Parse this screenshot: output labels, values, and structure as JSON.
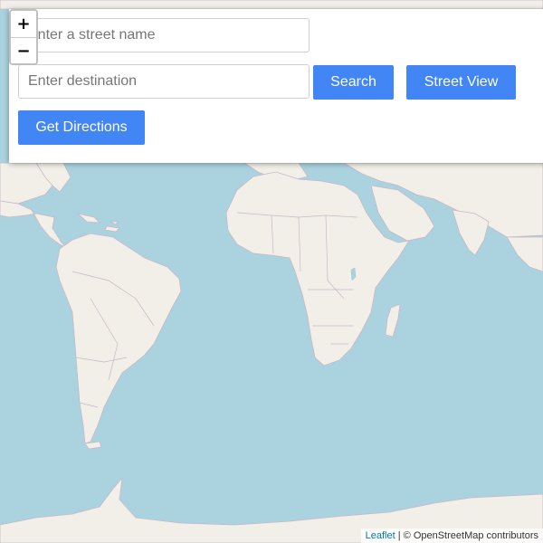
{
  "panel": {
    "street_placeholder": "Enter a street name",
    "destination_placeholder": "Enter destination",
    "search_label": "Search",
    "street_view_label": "Street View",
    "directions_label": "Get Directions"
  },
  "zoom": {
    "in_label": "+",
    "out_label": "−"
  },
  "attribution": {
    "leaflet_label": "Leaflet",
    "separator": " | © ",
    "osm_label": "OpenStreetMap contributors"
  },
  "colors": {
    "ocean": "#aad3df",
    "land": "#f2efe9",
    "button": "#4285f4"
  },
  "icons": [
    "zoom-in-icon",
    "zoom-out-icon"
  ]
}
